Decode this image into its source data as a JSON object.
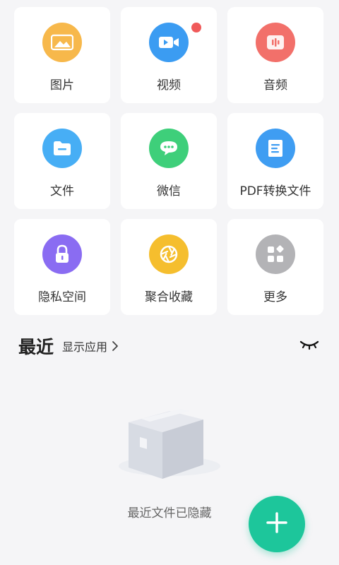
{
  "categories": [
    {
      "label": "图片",
      "icon": "image-icon",
      "color": "#f7b84b"
    },
    {
      "label": "视频",
      "icon": "video-icon",
      "color": "#3b9cf2"
    },
    {
      "label": "音频",
      "icon": "audio-icon",
      "color": "#f2706a"
    },
    {
      "label": "文件",
      "icon": "folder-icon",
      "color": "#47aef5"
    },
    {
      "label": "微信",
      "icon": "wechat-icon",
      "color": "#3ecf7a"
    },
    {
      "label": "PDF转换文件",
      "icon": "pdf-document-icon",
      "color": "#3f9df2"
    },
    {
      "label": "隐私空间",
      "icon": "lock-icon",
      "color": "#8a6cf2"
    },
    {
      "label": "聚合收藏",
      "icon": "aperture-icon",
      "color": "#f5be2e"
    },
    {
      "label": "更多",
      "icon": "more-apps-icon",
      "color": "#b3b3b6"
    }
  ],
  "recent": {
    "title": "最近",
    "show_apps_label": "显示应用",
    "empty_text": "最近文件已隐藏"
  },
  "fab": {
    "icon": "plus-icon",
    "color": "#1dc69b"
  },
  "badge_color": "#f05a5a"
}
